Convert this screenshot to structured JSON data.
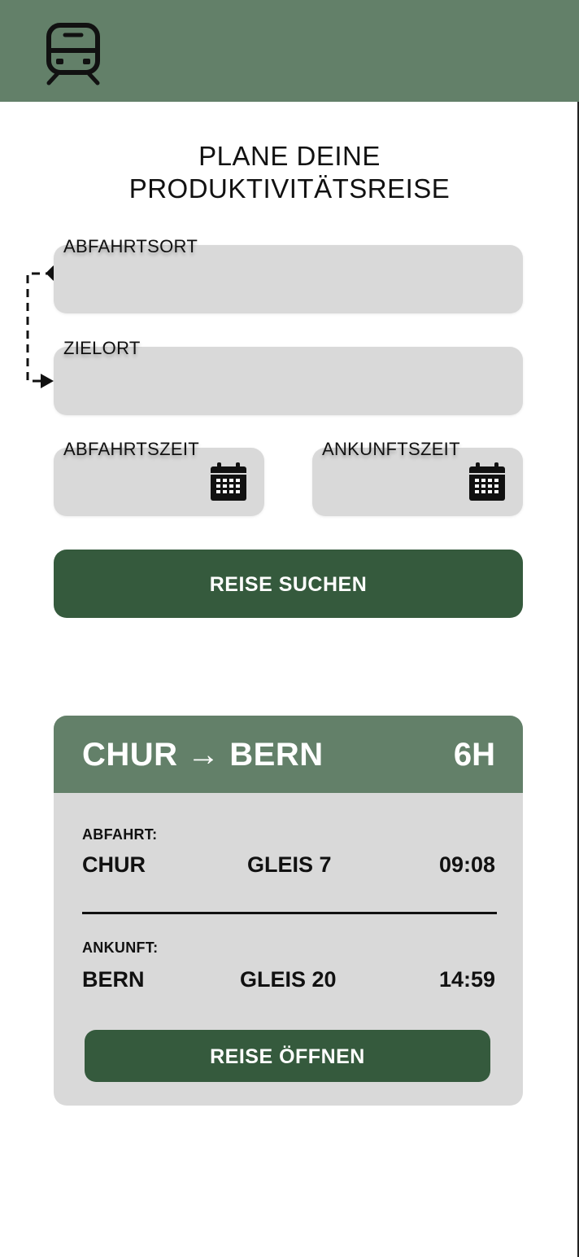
{
  "header": {
    "logo_icon": "train-icon",
    "background": "#638069"
  },
  "page": {
    "title_line1": "PLANE DEINE",
    "title_line2": "PRODUKTIVITÄTSREISE"
  },
  "form": {
    "departure_place_label": "ABFAHRTSORT",
    "destination_label": "ZIELORT",
    "departure_time_label": "ABFAHRTSZEIT",
    "arrival_time_label": "ANKUNFTSZEIT",
    "calendar_icon": "calendar-icon",
    "search_button": "REISE SUCHEN"
  },
  "result": {
    "route": "CHUR → BERN",
    "duration": "6H",
    "departure": {
      "label": "ABFAHRT:",
      "station": "CHUR",
      "platform": "GLEIS 7",
      "time": "09:08"
    },
    "arrival": {
      "label": "ANKUNFT:",
      "station": "BERN",
      "platform": "GLEIS 20",
      "time": "14:59"
    },
    "open_button": "REISE ÖFFNEN"
  },
  "colors": {
    "header_green": "#638069",
    "button_green": "#355a3d",
    "field_gray": "#d9d9d9"
  }
}
